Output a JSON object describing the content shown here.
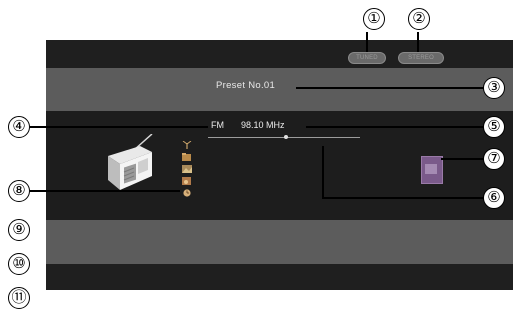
{
  "screen": {
    "status_tuned": "TUNED",
    "status_stereo": "STEREO",
    "preset": "Preset No.01",
    "band": "FM",
    "frequency": "98.10 MHz",
    "tuning_position": 0.51
  },
  "menu_icons": [
    "antenna-icon",
    "folder-icon",
    "photo-icon",
    "music-icon",
    "clock-icon"
  ],
  "callouts": [
    "①",
    "②",
    "③",
    "④",
    "⑤",
    "⑥",
    "⑦",
    "⑧",
    "⑨",
    "⑩",
    "⑪"
  ],
  "colors": {
    "screen_bg": "#5c5c5c",
    "panel_bg": "#1d1d1d",
    "bar_bg": "#1f1f1f",
    "badge": "#7a5a8a"
  }
}
